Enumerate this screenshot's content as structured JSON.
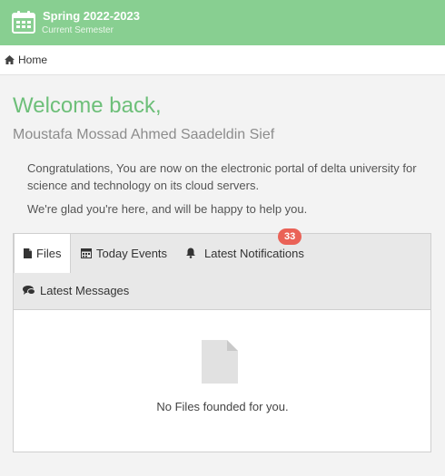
{
  "semester": {
    "title": "Spring 2022-2023",
    "subtitle": "Current Semester"
  },
  "breadcrumb": {
    "home": "Home"
  },
  "welcome": {
    "heading": "Welcome back,",
    "name": "Moustafa Mossad Ahmed Saadeldin Sief",
    "message": "Congratulations, You are now on the electronic portal of delta university for science and technology on its cloud servers.",
    "message2": "We're glad you're here, and will be happy to help you."
  },
  "tabs": {
    "files": "Files",
    "today_events": "Today Events",
    "notifications": "Latest Notifications",
    "notifications_count": "33",
    "messages": "Latest Messages"
  },
  "files_panel": {
    "empty_text": "No Files founded for you."
  },
  "colors": {
    "header": "#88cf91",
    "accent": "#6dbf79",
    "badge": "#ea6257"
  }
}
